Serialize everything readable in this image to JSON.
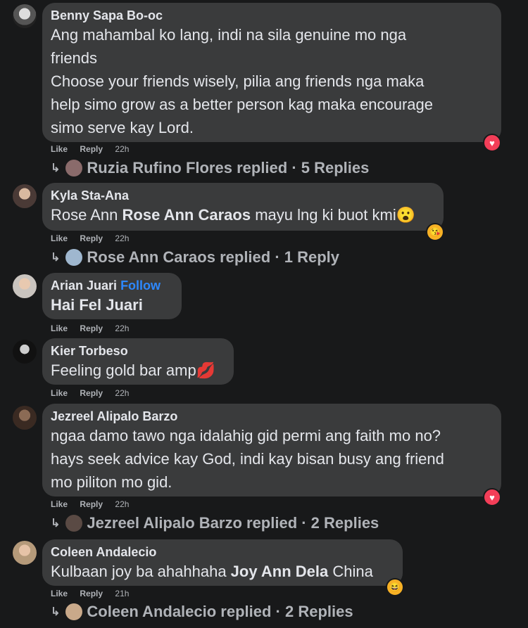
{
  "actions": {
    "like": "Like",
    "reply": "Reply"
  },
  "comments": [
    {
      "author": "Benny Sapa Bo-oc",
      "lines": [
        "Ang mahambal ko lang, indi na sila genuine mo nga",
        "friends",
        "Choose your friends wisely, pilia ang friends nga maka",
        "help simo grow as a better person kag maka encourage",
        "simo serve kay Lord."
      ],
      "time": "22h",
      "reaction": "heart-icon",
      "replies": "Ruzia Rufino Flores replied · 5 Replies"
    },
    {
      "author": "Kyla Sta-Ana",
      "text_pre": "Rose Ann ",
      "text_bold": "Rose Ann Caraos",
      "text_post": " mayu lng ki buot kmi😮",
      "time": "22h",
      "reaction": "kiss-emoji-icon",
      "replies": "Rose Ann Caraos replied · 1 Reply"
    },
    {
      "author": "Arian Juari",
      "follow": "Follow",
      "text_bold": "Hai Fel Juari",
      "time": "22h"
    },
    {
      "author": "Kier Torbeso",
      "text": "Feeling gold bar amp💋",
      "time": "22h"
    },
    {
      "author": "Jezreel Alipalo Barzo",
      "lines": [
        "ngaa damo tawo nga idalahig gid permi ang faith mo no?",
        "hays seek advice kay God, indi kay bisan busy ang friend",
        "mo piliton mo gid."
      ],
      "time": "22h",
      "reaction": "heart-icon",
      "replies": "Jezreel Alipalo Barzo replied · 2 Replies"
    },
    {
      "author": "Coleen Andalecio",
      "text_pre": "Kulbaan joy ba ahahhaha ",
      "text_bold": "Joy Ann Dela",
      "text_post": " China",
      "time": "21h",
      "reaction": "laugh-emoji-icon",
      "replies": "Coleen Andalecio replied · 2 Replies"
    }
  ]
}
